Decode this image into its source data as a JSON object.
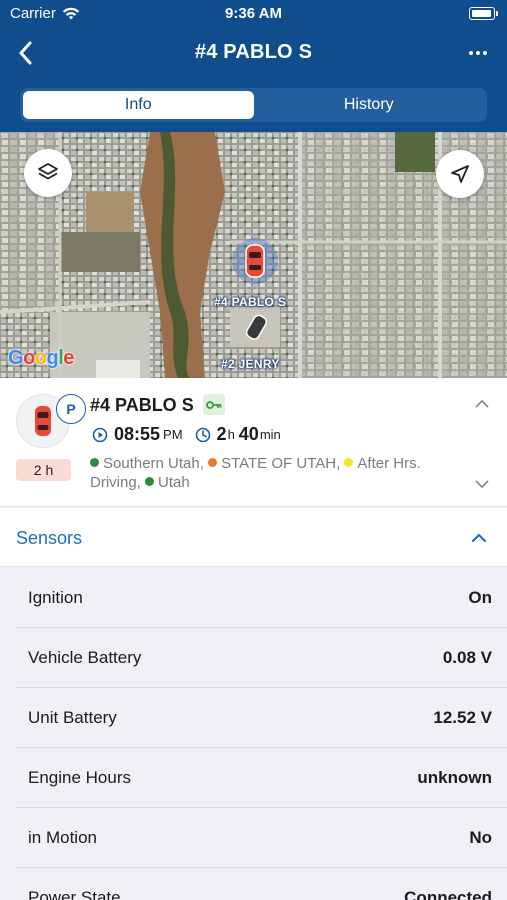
{
  "status_bar": {
    "carrier": "Carrier",
    "time": "9:36 AM"
  },
  "nav": {
    "title": "#4 PABLO S"
  },
  "tabs": [
    {
      "label": "Info",
      "active": true
    },
    {
      "label": "History",
      "active": false
    }
  ],
  "map": {
    "labels": {
      "primary": "#4 PABLO S",
      "secondary": "#2 JENRY"
    },
    "attribution": "Google"
  },
  "vehicle": {
    "name": "#4 PABLO S",
    "parking_badge": "P",
    "duration_badge": "2 h",
    "time": "08:55",
    "time_suffix": "PM",
    "elapsed_hours": "2",
    "elapsed_hours_unit": "h",
    "elapsed_minutes": "40",
    "elapsed_minutes_unit": "min",
    "groups": [
      {
        "name": "Southern Utah,",
        "color": "#2e8b3a"
      },
      {
        "name": "STATE OF UTAH,",
        "color": "#f07a24"
      },
      {
        "name": "After Hrs. Driving,",
        "color": "#f2e528"
      },
      {
        "name": "Utah",
        "color": "#2e8b3a"
      }
    ]
  },
  "sensors": {
    "title": "Sensors",
    "rows": [
      {
        "name": "Ignition",
        "value": "On"
      },
      {
        "name": "Vehicle Battery",
        "value": "0.08 V"
      },
      {
        "name": "Unit Battery",
        "value": "12.52 V"
      },
      {
        "name": "Engine Hours",
        "value": "unknown"
      },
      {
        "name": "in Motion",
        "value": "No"
      },
      {
        "name": "Power State",
        "value": "Connected"
      }
    ]
  },
  "colors": {
    "header": "#0f4d8c",
    "accent": "#1b6fc4",
    "vehicle_marker": "#e84a3a",
    "duration_badge_bg": "#fbdcd5"
  }
}
